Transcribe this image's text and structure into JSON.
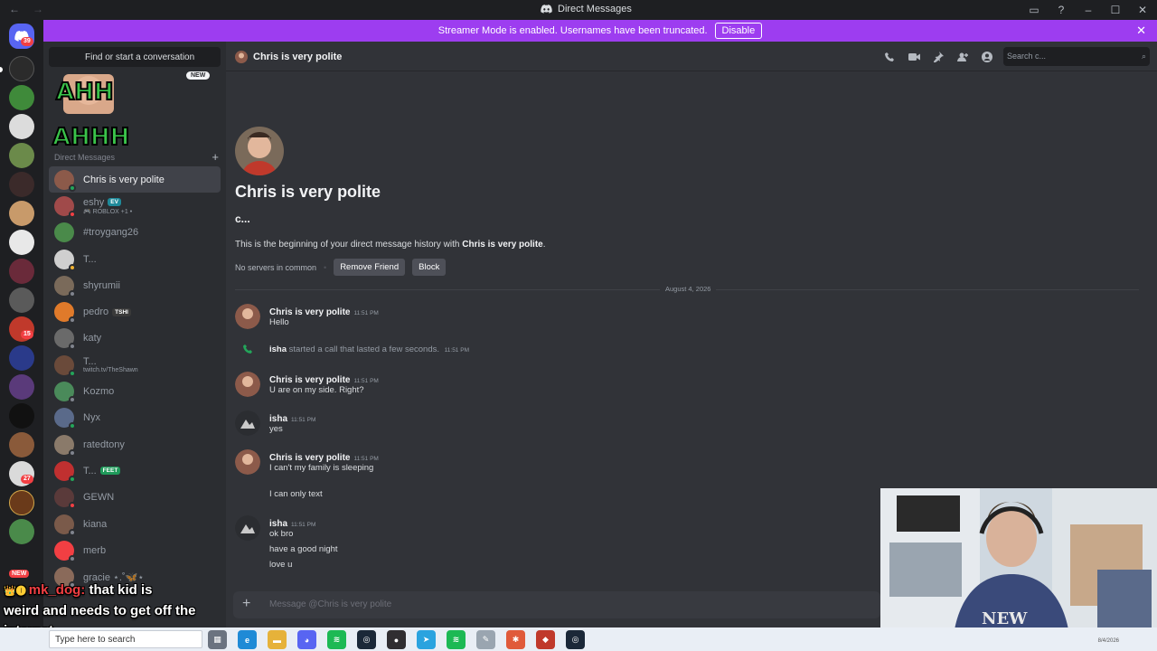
{
  "window": {
    "title": "Direct Messages",
    "streamer_banner": "Streamer Mode is enabled. Usernames have been truncated.",
    "disable_label": "Disable"
  },
  "rail": {
    "home_badge": "39",
    "badges": [
      "15",
      "27"
    ],
    "new_label": "NEW"
  },
  "sidebar": {
    "find_placeholder": "Find or start a conversation",
    "new_tag": "NEW",
    "section_label": "Direct Messages",
    "dms": [
      {
        "name": "Chris is very polite",
        "sub": "",
        "tag": "",
        "color": "#8c5a4a",
        "status": "#23a55a",
        "active": true
      },
      {
        "name": "eshy",
        "sub": "🎮 ROBLOX +1 •",
        "tag": "EV",
        "color": "#a04a4a",
        "status": "#f23f43",
        "active": false
      },
      {
        "name": "#troygang26",
        "sub": "",
        "tag": "",
        "color": "#4a8a4a",
        "status": "",
        "active": false
      },
      {
        "name": "T...",
        "sub": "",
        "tag": "",
        "color": "#cfcfcf",
        "status": "#f0b232",
        "active": false
      },
      {
        "name": "shyrumii",
        "sub": "",
        "tag": "",
        "color": "#7a6a5a",
        "status": "#80848e",
        "active": false
      },
      {
        "name": "pedro",
        "sub": "",
        "tag": "TSHI",
        "color": "#e07a2a",
        "status": "#80848e",
        "active": false
      },
      {
        "name": "katy",
        "sub": "",
        "tag": "",
        "color": "#6a6a6a",
        "status": "#80848e",
        "active": false
      },
      {
        "name": "T...",
        "sub": "twitch.tv/TheShawn",
        "tag": "",
        "color": "#6a4a3a",
        "status": "#23a55a",
        "active": false
      },
      {
        "name": "Kozmo",
        "sub": "",
        "tag": "",
        "color": "#4a8a5a",
        "status": "#80848e",
        "active": false
      },
      {
        "name": "Nyx",
        "sub": "",
        "tag": "",
        "color": "#5a6a8a",
        "status": "#23a55a",
        "active": false
      },
      {
        "name": "ratedtony",
        "sub": "",
        "tag": "",
        "color": "#8a7a6a",
        "status": "#80848e",
        "active": false
      },
      {
        "name": "T...",
        "sub": "",
        "tag": "FEET",
        "color": "#c03030",
        "status": "#23a55a",
        "active": false
      },
      {
        "name": "GEWN",
        "sub": "",
        "tag": "",
        "color": "#5a3a3a",
        "status": "#f23f43",
        "active": false
      },
      {
        "name": "kiana",
        "sub": "",
        "tag": "",
        "color": "#7a5a4a",
        "status": "#80848e",
        "active": false
      },
      {
        "name": "merb",
        "sub": "",
        "tag": "",
        "color": "#f23f43",
        "status": "#80848e",
        "active": false
      },
      {
        "name": "gracie ⋆.˚🦋⋆",
        "sub": "",
        "tag": "",
        "color": "#8a6a5a",
        "status": "#80848e",
        "active": false
      }
    ]
  },
  "caption": {
    "username": "mk_dog:",
    "message_start": "that kid is",
    "message_rest": "weird and needs to get off the internet"
  },
  "chat": {
    "header_name": "Chris is very polite",
    "search_placeholder": "Search c...",
    "hero_name": "Chris is very polite",
    "hero_username": "c...",
    "hero_desc_prefix": "This is the beginning of your direct message history with",
    "hero_desc_name": "Chris is very polite",
    "hero_desc_suffix": ".",
    "no_servers": "No servers in common",
    "remove_friend": "Remove Friend",
    "block": "Block",
    "date_divider": "August 4, 2026",
    "messages": [
      {
        "author": "Chris is very polite",
        "time": "11:51 PM",
        "lines": [
          "Hello"
        ]
      },
      {
        "author": "Chris is very polite",
        "time": "11:51 PM",
        "lines": [
          "U are on my side.  Right?"
        ]
      },
      {
        "author": "isha",
        "time": "11:51 PM",
        "lines": [
          "yes"
        ]
      },
      {
        "author": "Chris is very polite",
        "time": "11:51 PM",
        "lines": [
          "I can't my family is sleeping",
          "I can only text"
        ]
      },
      {
        "author": "isha",
        "time": "11:51 PM",
        "lines": [
          "ok bro",
          "have a good night",
          "love u"
        ]
      }
    ],
    "call_system": {
      "author": "isha",
      "text": "started a call that lasted a few seconds.",
      "time": "11:51 PM"
    },
    "composer_placeholder": "Message @Chris is very polite"
  },
  "taskbar": {
    "search_placeholder": "Type here to search",
    "icons": [
      "task-view",
      "edge",
      "file-explorer",
      "discord",
      "spotify",
      "steam",
      "obs",
      "telegram",
      "spotify-2",
      "tool",
      "app",
      "app-2",
      "steam-2"
    ],
    "clock": "8/4/2026"
  }
}
